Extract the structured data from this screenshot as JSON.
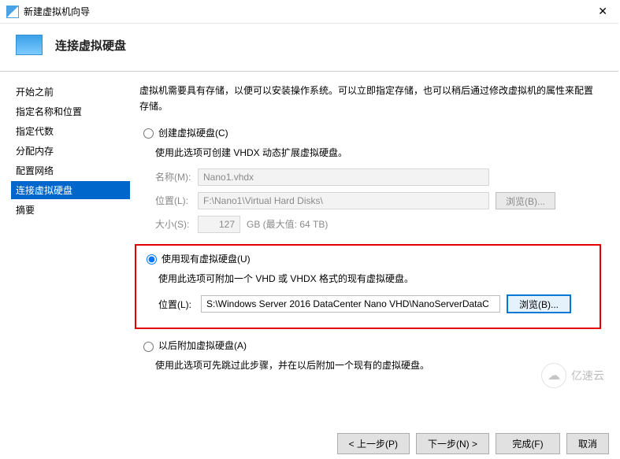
{
  "window": {
    "title": "新建虚拟机向导",
    "page_title": "连接虚拟硬盘"
  },
  "sidebar": {
    "items": [
      {
        "label": "开始之前"
      },
      {
        "label": "指定名称和位置"
      },
      {
        "label": "指定代数"
      },
      {
        "label": "分配内存"
      },
      {
        "label": "配置网络"
      },
      {
        "label": "连接虚拟硬盘"
      },
      {
        "label": "摘要"
      }
    ],
    "selected_index": 5
  },
  "main": {
    "intro": "虚拟机需要具有存储，以便可以安装操作系统。可以立即指定存储，也可以稍后通过修改虚拟机的属性来配置存储。",
    "option_create": {
      "label": "创建虚拟硬盘(C)",
      "desc": "使用此选项可创建 VHDX 动态扩展虚拟硬盘。",
      "name_label": "名称(M):",
      "name_value": "Nano1.vhdx",
      "loc_label": "位置(L):",
      "loc_value": "F:\\Nano1\\Virtual Hard Disks\\",
      "browse": "浏览(B)...",
      "size_label": "大小(S):",
      "size_value": "127",
      "size_note": "GB (最大值: 64 TB)"
    },
    "option_use": {
      "label": "使用现有虚拟硬盘(U)",
      "desc": "使用此选项可附加一个 VHD 或 VHDX 格式的现有虚拟硬盘。",
      "loc_label": "位置(L):",
      "loc_value": "S:\\Windows Server 2016 DataCenter Nano VHD\\NanoServerDataC",
      "browse": "浏览(B)..."
    },
    "option_later": {
      "label": "以后附加虚拟硬盘(A)",
      "desc": "使用此选项可先跳过此步骤，并在以后附加一个现有的虚拟硬盘。"
    }
  },
  "footer": {
    "prev": "< 上一步(P)",
    "next": "下一步(N) >",
    "finish": "完成(F)",
    "cancel": "取消"
  },
  "watermark": "亿速云"
}
